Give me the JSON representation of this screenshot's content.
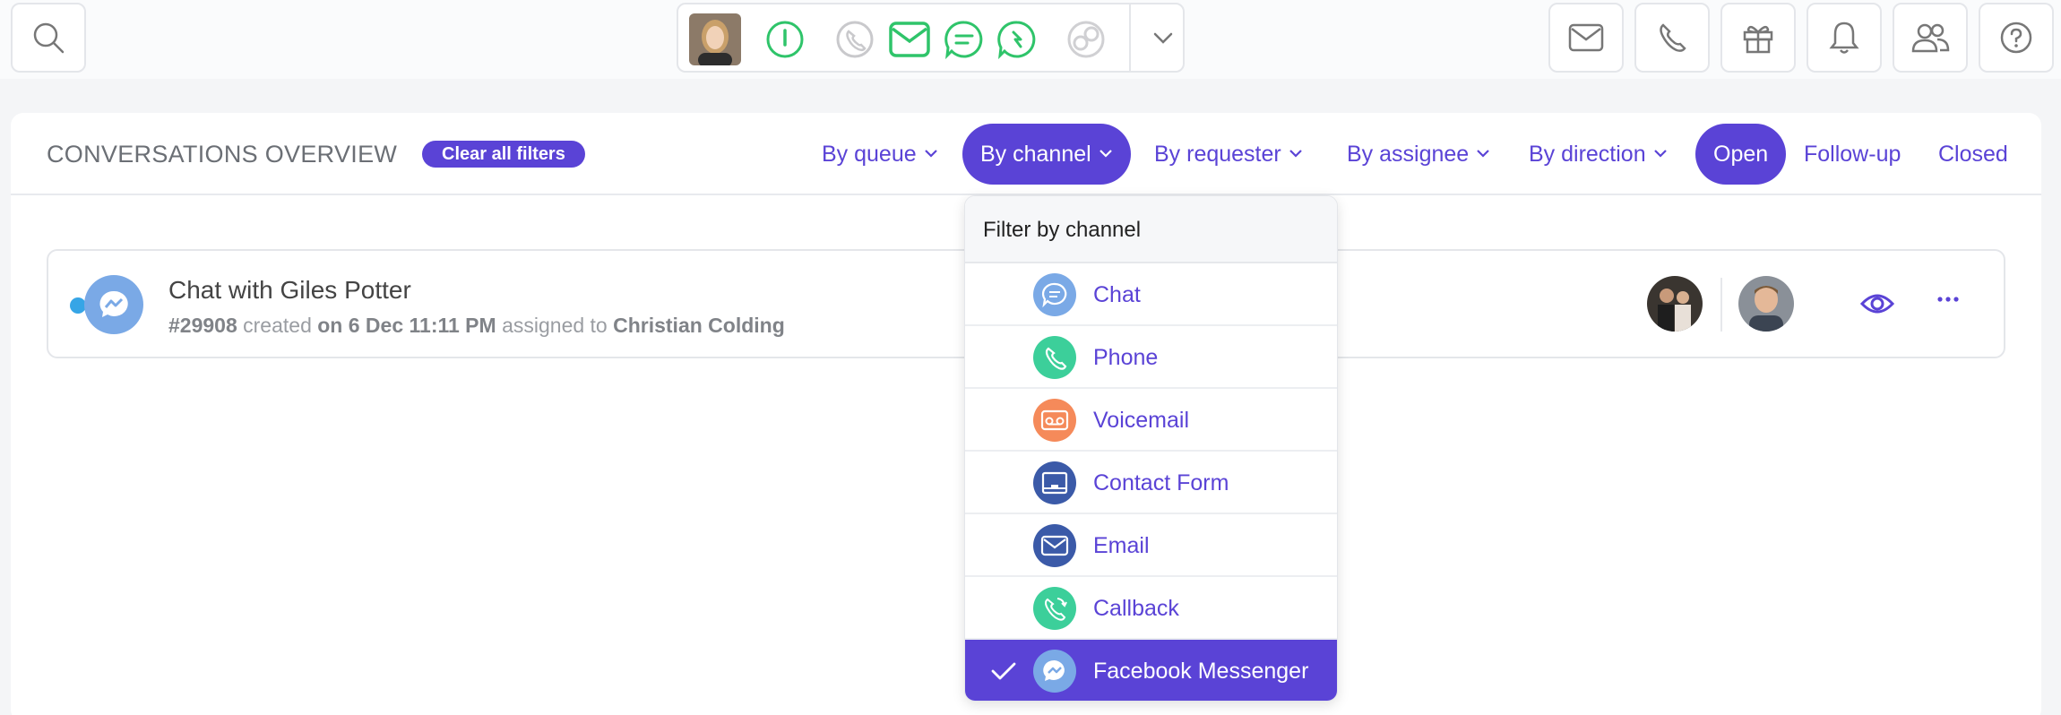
{
  "topbar": {
    "left_buttons": [
      {
        "icon": "search-icon"
      }
    ],
    "status_icons": [
      "power-icon",
      "phone-icon",
      "email-icon",
      "chat-icon",
      "callback-icon",
      "social-icon"
    ],
    "right_buttons": [
      "email-icon",
      "phone-icon",
      "gift-icon",
      "bell-icon",
      "team-icon",
      "help-icon"
    ]
  },
  "header": {
    "title": "CONVERSATIONS OVERVIEW",
    "clear_label": "Clear all filters",
    "filters": [
      "By queue",
      "By channel",
      "By requester",
      "By assignee",
      "By direction"
    ],
    "active_filter": "By channel",
    "status_tabs": [
      "Open",
      "Follow-up",
      "Closed"
    ],
    "active_status": "Open"
  },
  "conversation": {
    "title": "Chat with Giles Potter",
    "id": "#29908",
    "created_word": "created",
    "date": "on 6 Dec 11:11 PM",
    "assigned_word": "assigned to",
    "assignee": "Christian Colding",
    "channel_icon": "messenger-icon"
  },
  "dropdown": {
    "title": "Filter by channel",
    "items": [
      {
        "label": "Chat",
        "icon": "chat-icon",
        "color": "#7aa9e6",
        "selected": false
      },
      {
        "label": "Phone",
        "icon": "phone-icon",
        "color": "#3ccf9a",
        "selected": false
      },
      {
        "label": "Voicemail",
        "icon": "voicemail-icon",
        "color": "#f58a5a",
        "selected": false
      },
      {
        "label": "Contact Form",
        "icon": "contact-form-icon",
        "color": "#3b5aa8",
        "selected": false
      },
      {
        "label": "Email",
        "icon": "email-icon",
        "color": "#3b5aa8",
        "selected": false
      },
      {
        "label": "Callback",
        "icon": "callback-icon",
        "color": "#3ccf9a",
        "selected": false
      },
      {
        "label": "Facebook Messenger",
        "icon": "messenger-icon",
        "color": "#7aa9e6",
        "selected": true
      }
    ]
  },
  "colors": {
    "accent": "#5a43d6",
    "status_green": "#2fc46a",
    "unread_dot": "#36a5e6"
  }
}
